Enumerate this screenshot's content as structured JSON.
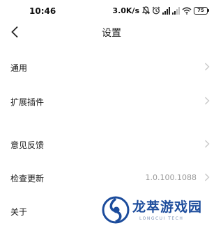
{
  "status_bar": {
    "time": "10:46",
    "network_speed": "3.0K/s",
    "icons": [
      "mute-icon",
      "alarm-icon",
      "signal-icon",
      "signal-icon",
      "wifi-icon",
      "battery-icon"
    ],
    "battery_level": "75"
  },
  "header": {
    "title": "设置",
    "back_icon": "chevron-left-icon"
  },
  "settings": {
    "items": [
      {
        "label": "通用",
        "value": ""
      },
      {
        "label": "扩展插件",
        "value": ""
      },
      {
        "label": "意见反馈",
        "value": ""
      },
      {
        "label": "检查更新",
        "value": "1.0.100.1088"
      },
      {
        "label": "关于",
        "value": ""
      }
    ]
  },
  "watermark": {
    "title": "龙萃游戏园",
    "subtitle": "LONGCUI TECH"
  },
  "colors": {
    "background": "#ffffff",
    "text": "#1a1a1a",
    "secondary_text": "#9a9a9a",
    "chevron": "#c8c8c8",
    "watermark_blue": "#1c4c9c"
  }
}
